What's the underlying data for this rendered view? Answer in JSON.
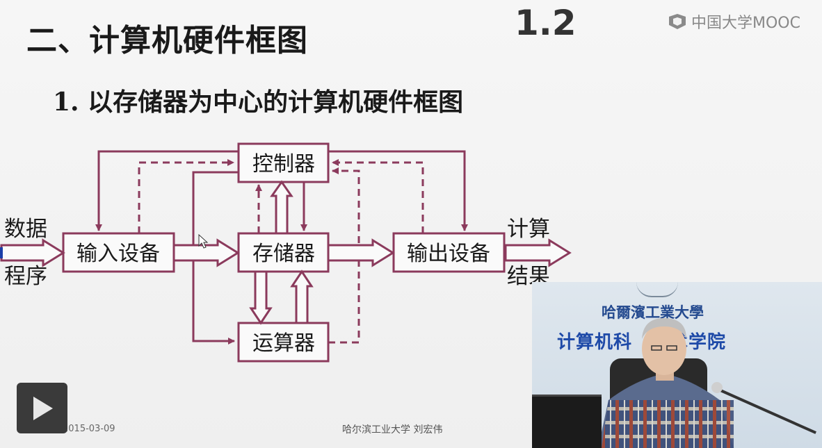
{
  "slide": {
    "title": "二、计算机硬件框图",
    "section_number": "1.2",
    "subtitle": "1. 以存储器为中心的计算机硬件框图"
  },
  "brand": {
    "name": "中国大学MOOC",
    "logo_icon": "mooc-logo-icon"
  },
  "diagram": {
    "stroke_color": "#8b3a5c",
    "boxes": {
      "controller": "控制器",
      "input_device": "输入设备",
      "memory": "存储器",
      "output_device": "输出设备",
      "alu": "运算器"
    },
    "left_labels": {
      "top": "数据",
      "bottom": "程序"
    },
    "right_labels": {
      "top": "计算",
      "bottom": "结果"
    }
  },
  "footer": {
    "date": "2015-03-09",
    "credit": "哈尔滨工业大学  刘宏伟"
  },
  "player": {
    "play_icon": "play-icon"
  },
  "webcam": {
    "wall_line1": "哈爾濱工業大學",
    "wall_line2_left": "计算机科",
    "wall_line2_right": "技术学院"
  }
}
